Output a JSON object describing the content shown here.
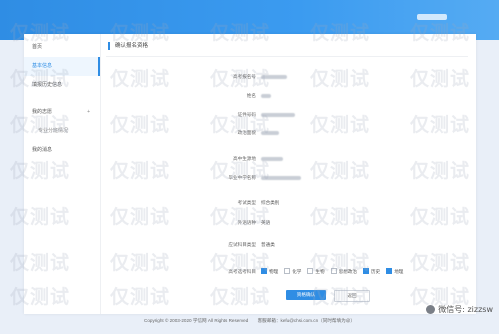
{
  "sidebar": {
    "items": [
      {
        "label": "首页",
        "active": false,
        "sub": false
      },
      {
        "label": "基本信息",
        "active": true,
        "sub": false
      },
      {
        "label": "填报历史信息",
        "active": false,
        "sub": false
      },
      {
        "label": "我的志愿",
        "active": false,
        "sub": false,
        "expand": "+"
      },
      {
        "label": "专业分班情况",
        "active": false,
        "sub": true
      },
      {
        "label": "我的消息",
        "active": false,
        "sub": false
      }
    ]
  },
  "main": {
    "title": "确认报名资格",
    "rows": [
      {
        "label": "高考报名号",
        "value": ""
      },
      {
        "label": "姓名",
        "value": ""
      },
      {
        "label": "证件号码",
        "value": ""
      },
      {
        "label": "政治面貌",
        "value": ""
      },
      {
        "label": "高中生源地",
        "value": ""
      },
      {
        "label": "毕业中学名称",
        "value": ""
      },
      {
        "label": "考试类型",
        "value": "综合类别"
      },
      {
        "label": "外语语种",
        "value": "英语"
      },
      {
        "label": "应试科目类型",
        "value": "普通类"
      }
    ],
    "subjects_label": "高考选考科目",
    "subjects": [
      {
        "name": "物理",
        "checked": true
      },
      {
        "name": "化学",
        "checked": false
      },
      {
        "name": "生物",
        "checked": false
      },
      {
        "name": "思想政治",
        "checked": false
      },
      {
        "name": "历史",
        "checked": true
      },
      {
        "name": "地理",
        "checked": true
      }
    ],
    "confirm_button": "资格确认",
    "back_button": "返回"
  },
  "footer": {
    "copyright": "Copyright © 2003-2020 学信网 All Rights Reserved",
    "email": "客服邮箱：kefu@chsi.com.cn（同时帮填为@）"
  },
  "watermark": {
    "text": "仅测试"
  },
  "badge": {
    "text": "微信号: zizzsw"
  }
}
